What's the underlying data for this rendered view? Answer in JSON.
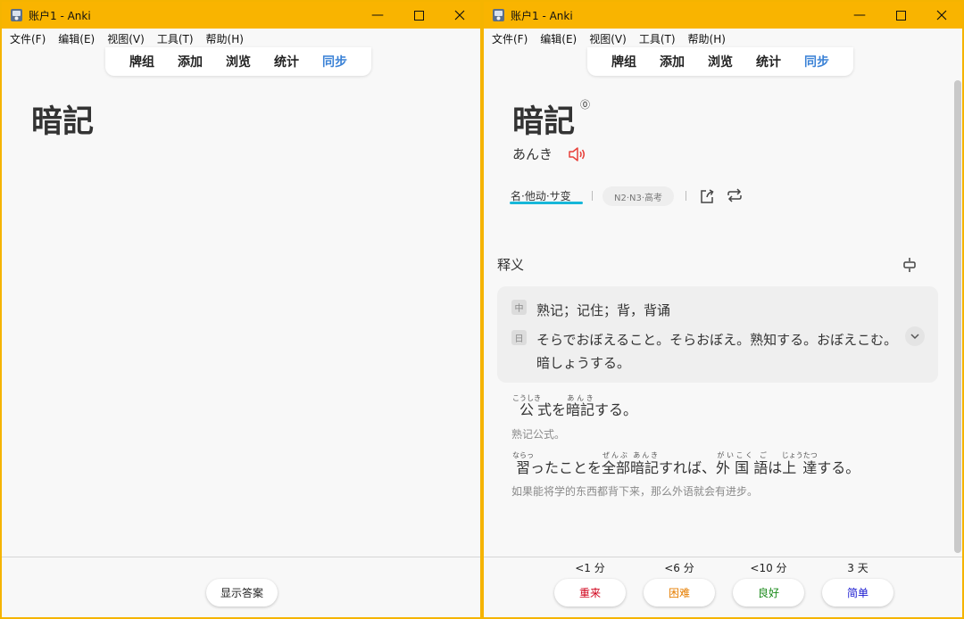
{
  "windows": {
    "left": {
      "title": "账户1 - Anki",
      "menu": [
        "文件(F)",
        "编辑(E)",
        "视图(V)",
        "工具(T)",
        "帮助(H)"
      ],
      "toolbar": [
        "牌组",
        "添加",
        "浏览",
        "统计",
        "同步"
      ],
      "word": "暗記",
      "show_answer": "显示答案"
    },
    "right": {
      "title": "账户1 - Anki",
      "menu": [
        "文件(F)",
        "编辑(E)",
        "视图(V)",
        "工具(T)",
        "帮助(H)"
      ],
      "toolbar": [
        "牌组",
        "添加",
        "浏览",
        "统计",
        "同步"
      ],
      "word": "暗記",
      "frequency_mark": "⓪",
      "reading": "あんき",
      "part_of_speech": "名·他动·サ变",
      "level_tag": "N2·N3·高考",
      "definition_title": "释义",
      "definition": {
        "cn_badge": "中",
        "cn": "熟记；记住；背，背诵",
        "jp_badge": "日",
        "jp": "そらでおぼえること。そらおぼえ。熟知する。おぼえこむ。暗しょうする。"
      },
      "examples": [
        {
          "jp_before": "",
          "segments": [
            {
              "base": "公",
              "ruby": "こうしき"
            },
            {
              "base": "式を",
              "ruby": ""
            },
            {
              "base": "暗記",
              "ruby": "あんき"
            },
            {
              "base": "する。",
              "ruby": ""
            }
          ],
          "cn": "熟记公式。"
        },
        {
          "segments": [
            {
              "base": "習",
              "ruby": "ならっ"
            },
            {
              "base": "ったことを",
              "ruby": ""
            },
            {
              "base": "全部暗記",
              "ruby": "ぜんぶ あんき"
            },
            {
              "base": "すれば、",
              "ruby": ""
            },
            {
              "base": "外 国 語",
              "ruby": "がいこく ご"
            },
            {
              "base": "は",
              "ruby": ""
            },
            {
              "base": "上 達",
              "ruby": "じょうたつ"
            },
            {
              "base": "する。",
              "ruby": ""
            }
          ],
          "cn": "如果能将学的东西都背下来，那么外语就会有进步。"
        }
      ],
      "answer_buttons": [
        {
          "interval": "<1 分",
          "label": "重来",
          "color": "#d0021b"
        },
        {
          "interval": "<6 分",
          "label": "困难",
          "color": "#e67e00"
        },
        {
          "interval": "<10 分",
          "label": "良好",
          "color": "#1a8a1a"
        },
        {
          "interval": "3 天",
          "label": "简单",
          "color": "#1a1ad0"
        }
      ]
    }
  },
  "colors": {
    "title_bar": "#f9b400",
    "sync_accent": "#3b82d6",
    "speaker": "#e8403a",
    "pos_underline": "#17b7d9"
  }
}
